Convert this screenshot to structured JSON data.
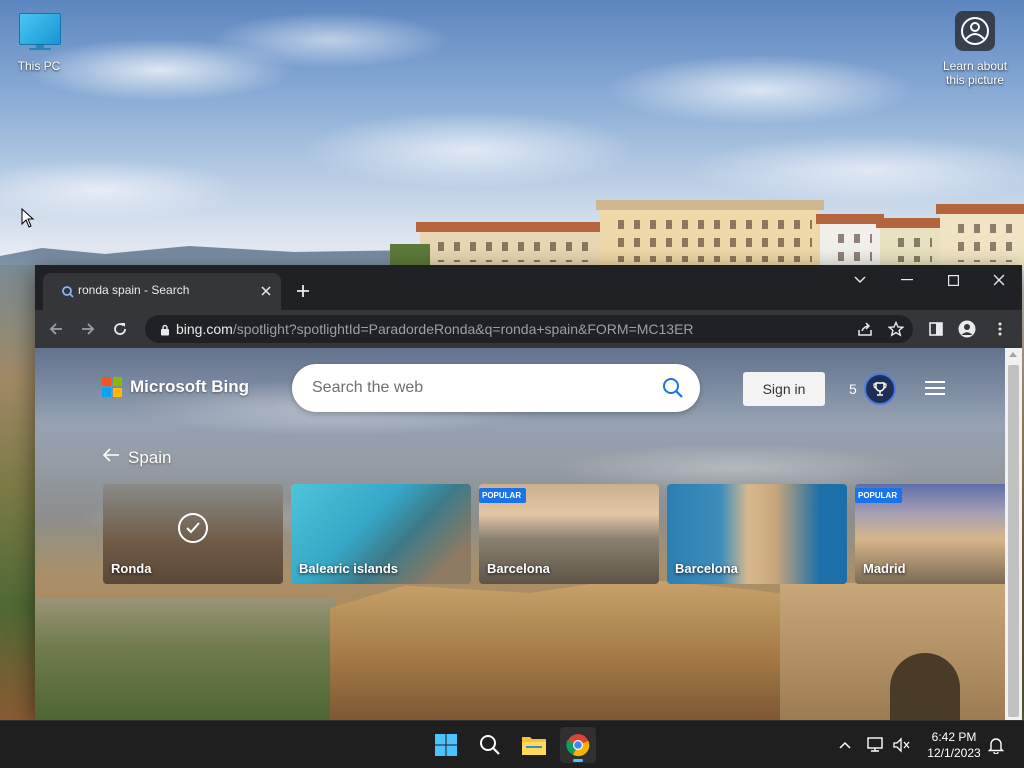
{
  "desktop": {
    "icons": [
      {
        "label": "This PC",
        "icon": "monitor-icon"
      },
      {
        "label": "Learn about this picture",
        "label_line1": "Learn about",
        "label_line2": "this picture",
        "icon": "camera-icon"
      }
    ]
  },
  "browser": {
    "tab": {
      "title": "ronda spain - Search",
      "favicon": "search-icon",
      "close_icon": "close-icon"
    },
    "new_tab_icon": "plus-icon",
    "window_controls": [
      "chevron-down-icon",
      "minimize-icon",
      "maximize-icon",
      "close-icon"
    ],
    "toolbar": {
      "back_icon": "arrow-left-icon",
      "forward_icon": "arrow-right-icon",
      "reload_icon": "reload-icon",
      "url_host": "bing.com",
      "url_path": "/spotlight?spotlightId=ParadordeRonda&q=ronda+spain&FORM=MC13ER",
      "actions": [
        "share-icon",
        "star-icon",
        "side-panel-icon",
        "profile-icon",
        "more-vert-icon"
      ]
    }
  },
  "bing": {
    "logo_text": "Microsoft Bing",
    "search": {
      "placeholder": "Search the web"
    },
    "sign_in": "Sign in",
    "points": "5",
    "back_label": "Spain",
    "cards": [
      {
        "label": "Ronda",
        "badge": "",
        "selected": true
      },
      {
        "label": "Balearic islands",
        "badge": "",
        "selected": false
      },
      {
        "label": "Barcelona",
        "badge": "POPULAR",
        "selected": false
      },
      {
        "label": "Barcelona",
        "badge": "",
        "selected": false
      },
      {
        "label": "Madrid",
        "badge": "POPULAR",
        "selected": false
      }
    ]
  },
  "taskbar": {
    "apps": [
      "windows-start-icon",
      "search-icon",
      "file-explorer-icon",
      "chrome-icon"
    ],
    "tray": [
      "chevron-up-icon",
      "network-icon",
      "volume-muted-icon",
      "notification-bell-icon"
    ],
    "time": "6:42 PM",
    "date": "12/1/2023"
  },
  "colors": {
    "accent": "#1a73e8",
    "taskbar_indicator": "#4cc2ff"
  }
}
